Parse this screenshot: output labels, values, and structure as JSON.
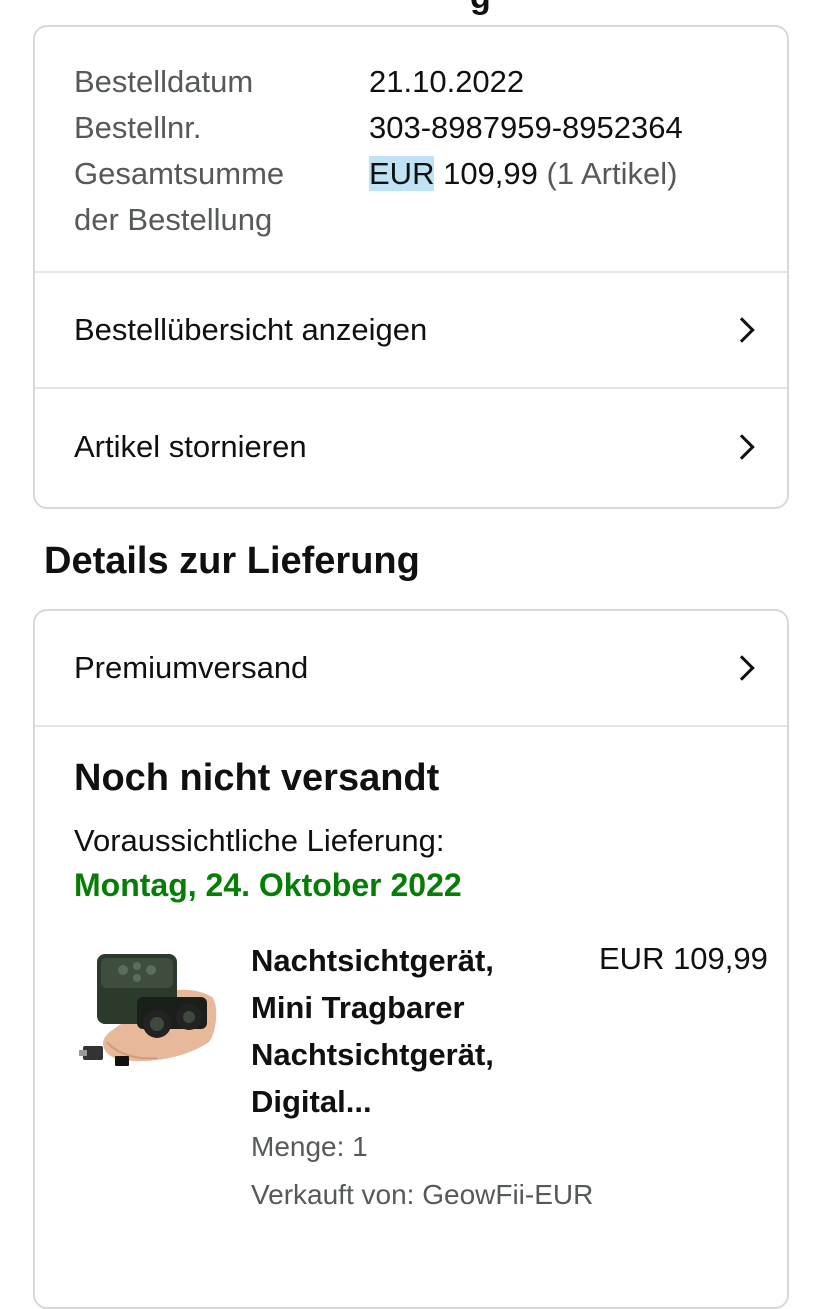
{
  "order": {
    "date_label": "Bestelldatum",
    "date_value": "21.10.2022",
    "number_label": "Bestellnr.",
    "number_value": "303-8987959-8952364",
    "total_label": "Gesamtsumme der Bestellung",
    "total_currency": "EUR",
    "total_amount": "109,99",
    "total_items": "(1 Artikel)"
  },
  "order_links": [
    {
      "label": "Bestellübersicht anzeigen"
    },
    {
      "label": "Artikel stornieren"
    }
  ],
  "delivery": {
    "section_title": "Details zur Lieferung",
    "shipping_method": "Premiumversand",
    "status": "Noch nicht versandt",
    "eta_label": "Voraussichtliche Lieferung:",
    "eta_date": "Montag, 24. Oktober 2022",
    "status_color": "#067d06"
  },
  "product": {
    "title": "Nachtsichtgerät, Mini Tragbarer Nachtsichtgerät, Digital...",
    "price": "EUR 109,99",
    "quantity": "Menge: 1",
    "seller": "Verkauft von: GeowFii-EUR",
    "image_icon": "night-vision-binocular-icon"
  }
}
